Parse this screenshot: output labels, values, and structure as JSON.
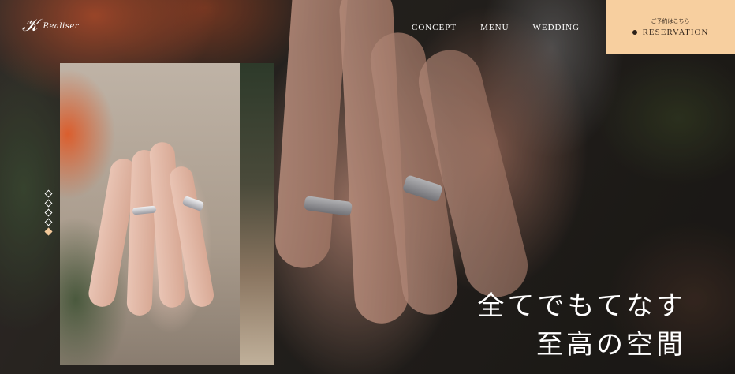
{
  "brand": {
    "logo_text": "Realiser",
    "logo_icon": "monogram-icon"
  },
  "nav": {
    "items": [
      "CONCEPT",
      "MENU",
      "WEDDING"
    ]
  },
  "reservation": {
    "sub": "ご予約はこちら",
    "label": "RESERVATION",
    "accent": "#f7cf9f"
  },
  "hero": {
    "line1": "全てでもてなす",
    "line2": "至高の空間"
  },
  "slider": {
    "count": 5,
    "active_index": 4
  }
}
